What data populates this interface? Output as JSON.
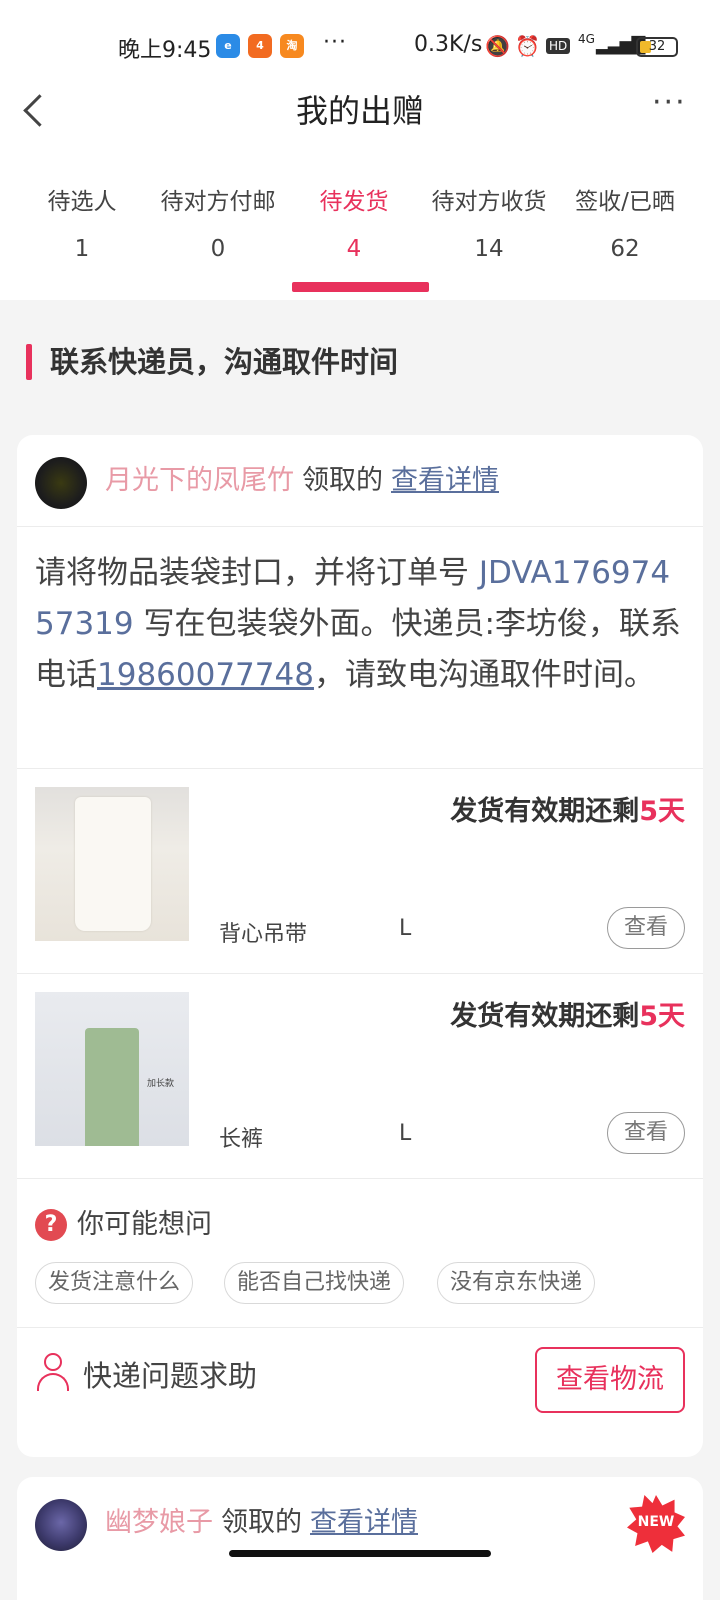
{
  "status_bar": {
    "time": "晚上9:45",
    "apps": [
      {
        "name": "browser-app-icon",
        "label": "e",
        "color": "#2b8be6"
      },
      {
        "name": "ticket-app-icon",
        "label": "4",
        "color": "#f26b21"
      },
      {
        "name": "taobao-app-icon",
        "label": "淘",
        "color": "#f7891f"
      }
    ],
    "more": "···",
    "net_speed": "0.3K/s",
    "network": "4G",
    "hd": "HD",
    "battery": "32"
  },
  "navbar": {
    "title": "我的出赠"
  },
  "tabs": [
    {
      "label": "待选人",
      "count": "1",
      "active": false
    },
    {
      "label": "待对方付邮",
      "count": "0",
      "active": false
    },
    {
      "label": "待发货",
      "count": "4",
      "active": true
    },
    {
      "label": "待对方收货",
      "count": "14",
      "active": false
    },
    {
      "label": "签收/已晒",
      "count": "62",
      "active": false
    }
  ],
  "section_title": "联系快递员，沟通取件时间",
  "card1": {
    "user": {
      "name": "月光下的凤尾竹",
      "claimed": "领取的",
      "detail_link": "查看详情"
    },
    "notice": {
      "part1": "请将物品装袋封口，并将订单号 ",
      "order_no": "JDVA17697457319",
      "part2": " 写在包装袋外面。快递员:李坊俊，联系电话",
      "phone": "19860077748",
      "part3": "，请致电沟通取件时间。"
    },
    "items": [
      {
        "deadline_prefix": "发货有效期还剩",
        "days": "5天",
        "name": "背心吊带",
        "size": "L",
        "view": "查看"
      },
      {
        "deadline_prefix": "发货有效期还剩",
        "days": "5天",
        "name": "长裤",
        "size": "L",
        "view": "查看",
        "tag": "加长款"
      }
    ],
    "faq": {
      "icon": "?",
      "title": "你可能想问",
      "chips": [
        "发货注意什么",
        "能否自己找快递",
        "没有京东快递"
      ]
    },
    "help_label": "快递问题求助",
    "logistics_button": "查看物流"
  },
  "card2": {
    "user": {
      "name": "幽梦娘子",
      "claimed": "领取的",
      "detail_link": "查看详情"
    },
    "badge": "NEW"
  },
  "colors": {
    "accent": "#e8315c",
    "link": "#5a6f9c",
    "username": "#e89aa6"
  }
}
